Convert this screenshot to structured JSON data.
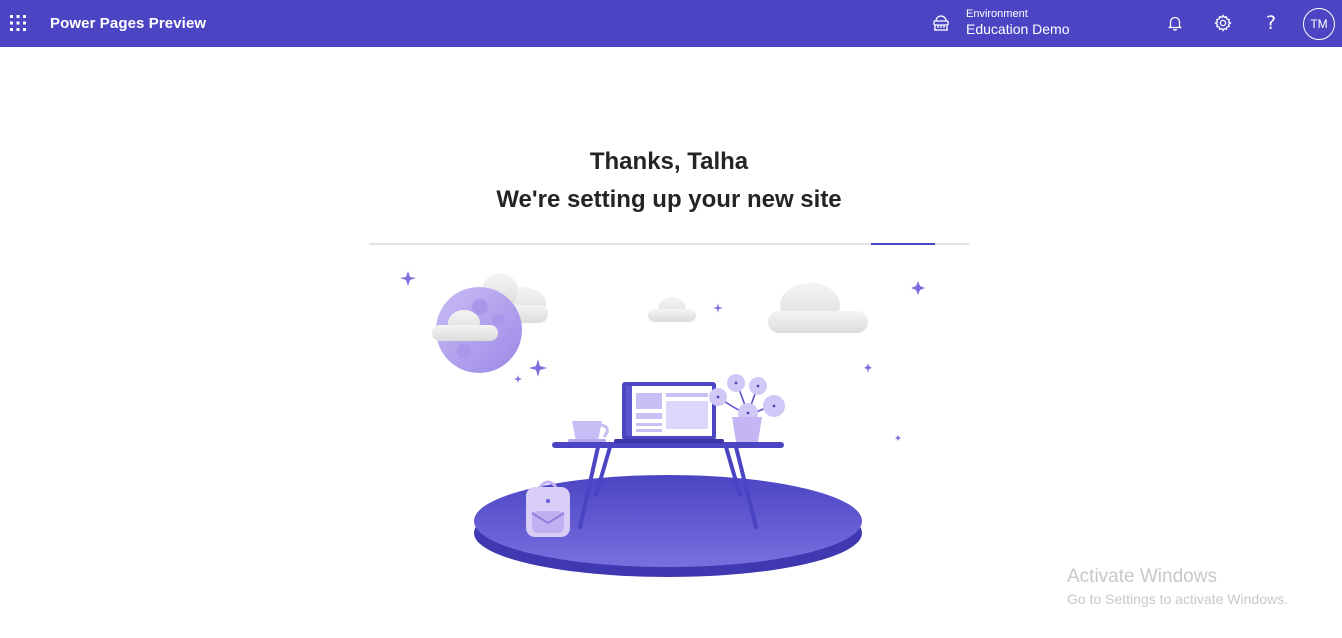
{
  "header": {
    "app_title": "Power Pages Preview",
    "environment_label": "Environment",
    "environment_value": "Education Demo",
    "avatar_initials": "TM",
    "help_glyph": "?",
    "icons": [
      "waffle-icon",
      "environment-icon",
      "bell-icon",
      "gear-icon",
      "help-icon"
    ],
    "bar_color": "#4b45c3"
  },
  "main": {
    "greeting": "Thanks, Talha",
    "status": "We're setting up your new site",
    "progress": 0.89,
    "illustration": "desk-laptop-scene"
  },
  "watermark": {
    "title": "Activate Windows",
    "subtitle": "Go to Settings to activate Windows."
  }
}
